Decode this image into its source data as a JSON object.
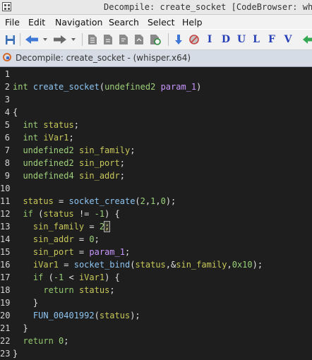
{
  "window": {
    "title": "Decompile: create_socket [CodeBrowser: whis"
  },
  "menu": [
    "File",
    "Edit",
    "Navigation",
    "Search",
    "Select",
    "Help"
  ],
  "toolbar": {
    "letters": [
      "I",
      "D",
      "U",
      "L",
      "F",
      "V"
    ],
    "icons": [
      "save-icon",
      "back-arrow-icon",
      "forward-arrow-icon",
      "bookmark-icon",
      "copy-icon",
      "paste-icon",
      "export-icon",
      "snapshot-icon",
      "down-arrow-icon",
      "stop-icon",
      "green-arrow-icon"
    ]
  },
  "panel": {
    "title": "Decompile: create_socket -  (whisper.x64)"
  },
  "colors": {
    "editor_bg": "#1e1e1e",
    "type": "#9ed07a",
    "variable": "#c8c85a",
    "function": "#8ec4f0",
    "param": "#c896ff"
  },
  "code": [
    {
      "n": "1",
      "t": []
    },
    {
      "n": "2",
      "t": [
        [
          "type",
          "int"
        ],
        [
          "plain",
          " "
        ],
        [
          "func",
          "create_socket"
        ],
        [
          "plain",
          "("
        ],
        [
          "type",
          "undefined2"
        ],
        [
          "plain",
          " "
        ],
        [
          "param",
          "param_1"
        ],
        [
          "plain",
          ")"
        ]
      ]
    },
    {
      "n": "3",
      "t": []
    },
    {
      "n": "4",
      "t": [
        [
          "plain",
          "{"
        ]
      ]
    },
    {
      "n": "5",
      "t": [
        [
          "plain",
          "  "
        ],
        [
          "type",
          "int"
        ],
        [
          "plain",
          " "
        ],
        [
          "var",
          "status"
        ],
        [
          "plain",
          ";"
        ]
      ]
    },
    {
      "n": "6",
      "t": [
        [
          "plain",
          "  "
        ],
        [
          "type",
          "int"
        ],
        [
          "plain",
          " "
        ],
        [
          "var",
          "iVar1"
        ],
        [
          "plain",
          ";"
        ]
      ]
    },
    {
      "n": "7",
      "t": [
        [
          "plain",
          "  "
        ],
        [
          "type",
          "undefined2"
        ],
        [
          "plain",
          " "
        ],
        [
          "var",
          "sin_family"
        ],
        [
          "plain",
          ";"
        ]
      ]
    },
    {
      "n": "8",
      "t": [
        [
          "plain",
          "  "
        ],
        [
          "type",
          "undefined2"
        ],
        [
          "plain",
          " "
        ],
        [
          "var",
          "sin_port"
        ],
        [
          "plain",
          ";"
        ]
      ]
    },
    {
      "n": "9",
      "t": [
        [
          "plain",
          "  "
        ],
        [
          "type",
          "undefined4"
        ],
        [
          "plain",
          " "
        ],
        [
          "var",
          "sin_addr"
        ],
        [
          "plain",
          ";"
        ]
      ]
    },
    {
      "n": "10",
      "t": []
    },
    {
      "n": "11",
      "t": [
        [
          "plain",
          "  "
        ],
        [
          "var",
          "status"
        ],
        [
          "plain",
          " = "
        ],
        [
          "func",
          "socket_create"
        ],
        [
          "plain",
          "("
        ],
        [
          "num",
          "2"
        ],
        [
          "plain",
          ","
        ],
        [
          "num",
          "1"
        ],
        [
          "plain",
          ","
        ],
        [
          "num",
          "0"
        ],
        [
          "plain",
          ");"
        ]
      ]
    },
    {
      "n": "12",
      "t": [
        [
          "plain",
          "  "
        ],
        [
          "kw",
          "if"
        ],
        [
          "plain",
          " ("
        ],
        [
          "var",
          "status"
        ],
        [
          "plain",
          " != "
        ],
        [
          "num",
          "-1"
        ],
        [
          "plain",
          ") {"
        ]
      ]
    },
    {
      "n": "13",
      "t": [
        [
          "plain",
          "    "
        ],
        [
          "var",
          "sin_family"
        ],
        [
          "plain",
          " = "
        ],
        [
          "num",
          "2"
        ],
        [
          "cursor",
          ";"
        ]
      ]
    },
    {
      "n": "14",
      "t": [
        [
          "plain",
          "    "
        ],
        [
          "var",
          "sin_addr"
        ],
        [
          "plain",
          " = "
        ],
        [
          "num",
          "0"
        ],
        [
          "plain",
          ";"
        ]
      ]
    },
    {
      "n": "15",
      "t": [
        [
          "plain",
          "    "
        ],
        [
          "var",
          "sin_port"
        ],
        [
          "plain",
          " = "
        ],
        [
          "param",
          "param_1"
        ],
        [
          "plain",
          ";"
        ]
      ]
    },
    {
      "n": "16",
      "t": [
        [
          "plain",
          "    "
        ],
        [
          "var",
          "iVar1"
        ],
        [
          "plain",
          " = "
        ],
        [
          "func",
          "socket_bind"
        ],
        [
          "plain",
          "("
        ],
        [
          "var",
          "status"
        ],
        [
          "plain",
          ",&"
        ],
        [
          "var",
          "sin_family"
        ],
        [
          "plain",
          ","
        ],
        [
          "num",
          "0x10"
        ],
        [
          "plain",
          ");"
        ]
      ]
    },
    {
      "n": "17",
      "t": [
        [
          "plain",
          "    "
        ],
        [
          "kw",
          "if"
        ],
        [
          "plain",
          " ("
        ],
        [
          "num",
          "-1"
        ],
        [
          "plain",
          " < "
        ],
        [
          "var",
          "iVar1"
        ],
        [
          "plain",
          ") {"
        ]
      ]
    },
    {
      "n": "18",
      "t": [
        [
          "plain",
          "      "
        ],
        [
          "kw",
          "return"
        ],
        [
          "plain",
          " "
        ],
        [
          "var",
          "status"
        ],
        [
          "plain",
          ";"
        ]
      ]
    },
    {
      "n": "19",
      "t": [
        [
          "plain",
          "    }"
        ]
      ]
    },
    {
      "n": "20",
      "t": [
        [
          "plain",
          "    "
        ],
        [
          "func",
          "FUN_00401992"
        ],
        [
          "plain",
          "("
        ],
        [
          "var",
          "status"
        ],
        [
          "plain",
          ");"
        ]
      ]
    },
    {
      "n": "21",
      "t": [
        [
          "plain",
          "  }"
        ]
      ]
    },
    {
      "n": "22",
      "t": [
        [
          "plain",
          "  "
        ],
        [
          "kw",
          "return"
        ],
        [
          "plain",
          " "
        ],
        [
          "num",
          "0"
        ],
        [
          "plain",
          ";"
        ]
      ]
    },
    {
      "n": "23",
      "t": [
        [
          "plain",
          "}"
        ]
      ]
    }
  ]
}
